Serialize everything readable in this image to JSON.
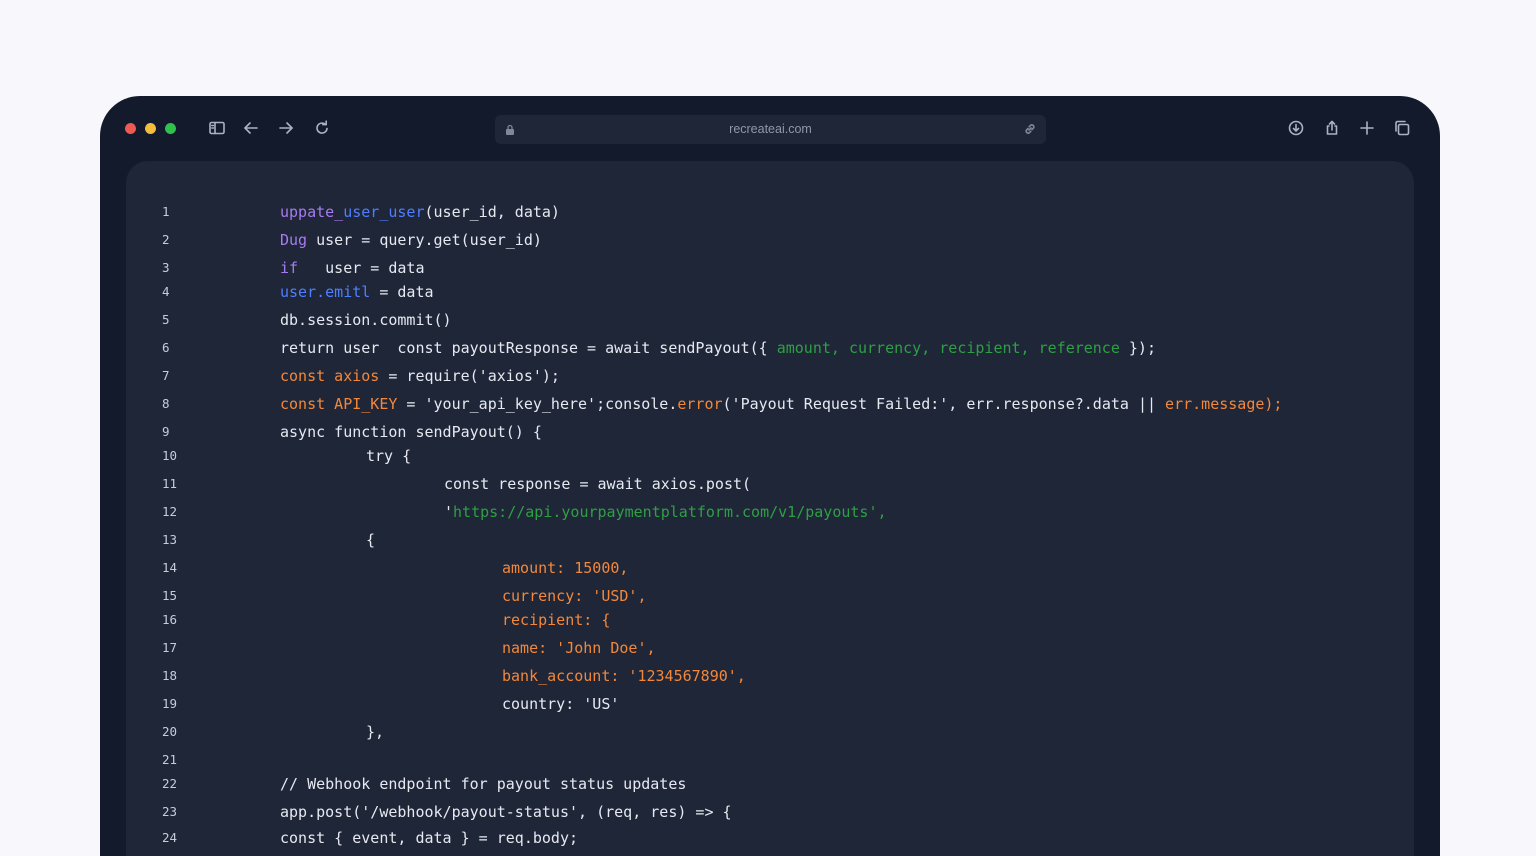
{
  "browser": {
    "url": "recreateai.com",
    "icons": [
      "sidebar-icon",
      "back-icon",
      "forward-icon",
      "reload-icon",
      "download-icon",
      "share-icon",
      "new-tab-icon",
      "tabs-icon"
    ]
  },
  "colors": {
    "plain": "#e6e9f0",
    "purple": "#a77bf0",
    "blue": "#4f7fff",
    "orange": "#f3883a",
    "green": "#2ea043"
  },
  "code_lines": [
    {
      "n": "1",
      "indent": 0,
      "tokens": [
        {
          "t": "uppate_",
          "c": "purple"
        },
        {
          "t": "user_user",
          "c": "blue"
        },
        {
          "t": "(user_id, data)",
          "c": "plain"
        }
      ]
    },
    {
      "n": "2",
      "indent": 0,
      "tokens": [
        {
          "t": "Dug",
          "c": "purple"
        },
        {
          "t": " user = query.get(user_id)",
          "c": "plain"
        }
      ]
    },
    {
      "n": "3",
      "indent": 0,
      "tokens": [
        {
          "t": "if",
          "c": "purple"
        },
        {
          "t": "   user = data",
          "c": "plain"
        }
      ]
    },
    {
      "n": "4",
      "indent": 0,
      "tokens": [
        {
          "t": "user.emitl",
          "c": "blue"
        },
        {
          "t": " = data",
          "c": "plain"
        }
      ]
    },
    {
      "n": "5",
      "indent": 0,
      "tokens": [
        {
          "t": "db.session.commit()",
          "c": "plain"
        }
      ]
    },
    {
      "n": "6",
      "indent": 0,
      "tokens": [
        {
          "t": "return user  const payoutResponse = await sendPayout({ ",
          "c": "plain"
        },
        {
          "t": "amount, currency, recipient, reference",
          "c": "green"
        },
        {
          "t": " });",
          "c": "plain"
        }
      ]
    },
    {
      "n": "7",
      "indent": 0,
      "tokens": [
        {
          "t": "const axios",
          "c": "orange"
        },
        {
          "t": " = require('axios');",
          "c": "plain"
        }
      ]
    },
    {
      "n": "8",
      "indent": 0,
      "tokens": [
        {
          "t": "const API_KEY",
          "c": "orange"
        },
        {
          "t": " = 'your_api_key_here';console.",
          "c": "plain"
        },
        {
          "t": "error",
          "c": "orange"
        },
        {
          "t": "('Payout Request Failed:', err.response?.data || ",
          "c": "plain"
        },
        {
          "t": "err.message);",
          "c": "orange"
        }
      ]
    },
    {
      "n": "9",
      "indent": 0,
      "tokens": [
        {
          "t": "async function sendPayout() {",
          "c": "plain"
        }
      ]
    },
    {
      "n": "10",
      "indent": 1,
      "tokens": [
        {
          "t": "try {",
          "c": "plain"
        }
      ]
    },
    {
      "n": "11",
      "indent": 2,
      "tokens": [
        {
          "t": "const response = await axios.post(",
          "c": "plain"
        }
      ]
    },
    {
      "n": "12",
      "indent": 2,
      "tokens": [
        {
          "t": "'",
          "c": "plain"
        },
        {
          "t": "https://api.yourpaymentplatform.com/v1/payouts',",
          "c": "green"
        }
      ]
    },
    {
      "n": "13",
      "indent": 1,
      "tokens": [
        {
          "t": "{",
          "c": "plain"
        }
      ]
    },
    {
      "n": "14",
      "indent": 3,
      "tokens": [
        {
          "t": "amount: 15000,",
          "c": "orange"
        }
      ]
    },
    {
      "n": "15",
      "indent": 3,
      "tokens": [
        {
          "t": "currency: 'USD',",
          "c": "orange"
        }
      ]
    },
    {
      "n": "16",
      "indent": 3,
      "tokens": [
        {
          "t": "recipient: {",
          "c": "orange"
        }
      ]
    },
    {
      "n": "17",
      "indent": 3,
      "tokens": [
        {
          "t": "name: 'John Doe',",
          "c": "orange"
        }
      ]
    },
    {
      "n": "18",
      "indent": 3,
      "tokens": [
        {
          "t": "bank_account: '1234567890',",
          "c": "orange"
        }
      ]
    },
    {
      "n": "19",
      "indent": 3,
      "tokens": [
        {
          "t": "country: 'US'",
          "c": "plain"
        }
      ]
    },
    {
      "n": "20",
      "indent": 1,
      "tokens": [
        {
          "t": "},",
          "c": "plain"
        }
      ]
    },
    {
      "n": "21",
      "indent": 0,
      "tokens": []
    },
    {
      "n": "22",
      "indent": 0,
      "tokens": [
        {
          "t": "// Webhook endpoint for payout status updates",
          "c": "plain"
        }
      ]
    },
    {
      "n": "23",
      "indent": 0,
      "tokens": [
        {
          "t": "app.post('/webhook/payout-status', (req, res) => {",
          "c": "plain"
        }
      ]
    },
    {
      "n": "24",
      "indent": 0,
      "tokens": [
        {
          "t": "const { event, data } = req.body;",
          "c": "plain"
        }
      ]
    }
  ]
}
